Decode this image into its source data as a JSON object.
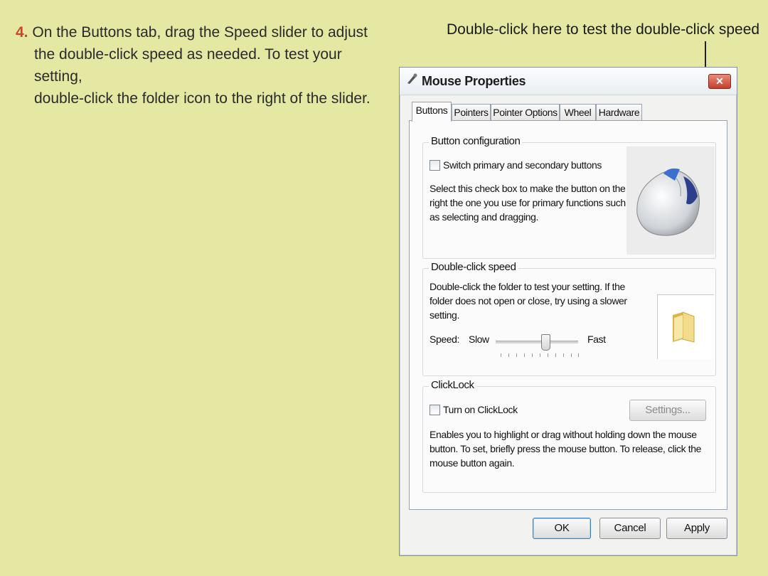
{
  "instruction": {
    "number": "4.",
    "line1": "On the Buttons tab, drag the Speed slider to adjust",
    "line2": "the double-click speed as needed. To test your setting,",
    "line3": "double-click the folder icon to the right of the slider."
  },
  "callout": "Double-click here to test the double-click speed",
  "window": {
    "title": "Mouse Properties",
    "title_icon": "mouse-icon",
    "close_label": "✕",
    "tabs": [
      {
        "label": "Buttons",
        "active": true
      },
      {
        "label": "Pointers",
        "active": false
      },
      {
        "label": "Pointer Options",
        "active": false
      },
      {
        "label": "Wheel",
        "active": false
      },
      {
        "label": "Hardware",
        "active": false
      }
    ],
    "button_config": {
      "legend": "Button configuration",
      "checkbox_label": "Switch primary and secondary buttons",
      "checked": false,
      "desc_lines": [
        "Select this check box to make the button on the",
        "right the one you use for primary functions such",
        "as selecting and dragging."
      ]
    },
    "double_click": {
      "legend": "Double-click speed",
      "desc_lines": [
        "Double-click the folder to test your setting. If the",
        "folder does not open or close, try using a slower",
        "setting."
      ],
      "speed_label": "Speed:",
      "slow_label": "Slow",
      "fast_label": "Fast",
      "speed_value": 0.6
    },
    "clicklock": {
      "legend": "ClickLock",
      "checkbox_label": "Turn on ClickLock",
      "checked": false,
      "settings_label": "Settings...",
      "desc_lines": [
        "Enables you to highlight or drag without holding down the mouse",
        "button. To set, briefly press the mouse button. To release, click the",
        "mouse button again."
      ]
    },
    "buttons": {
      "ok": "OK",
      "cancel": "Cancel",
      "apply": "Apply"
    }
  }
}
